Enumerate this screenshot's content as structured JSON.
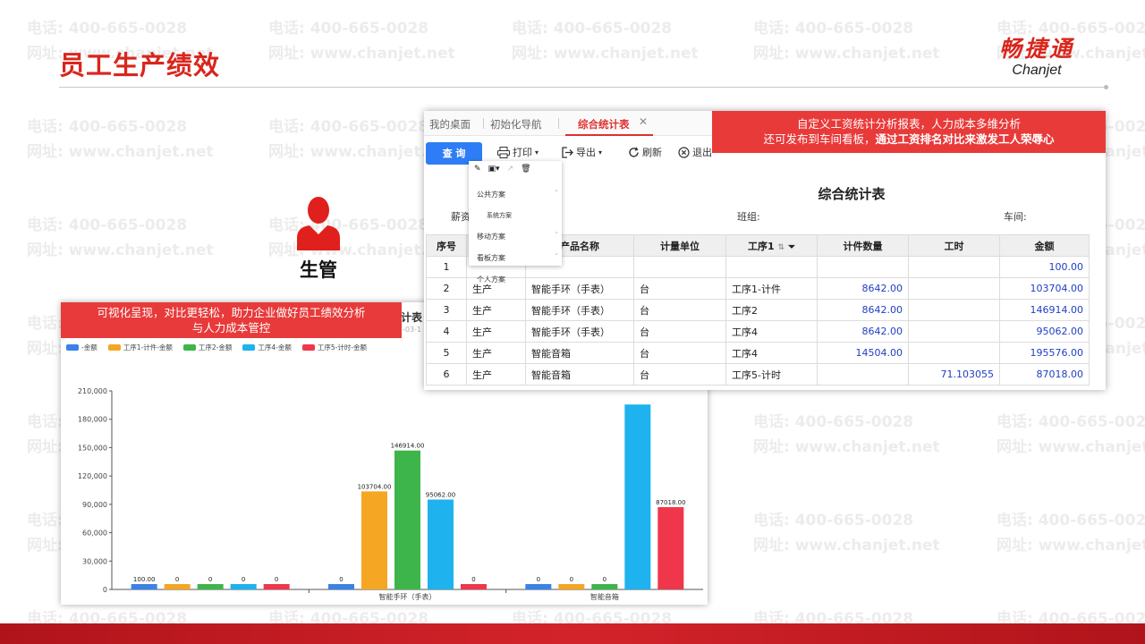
{
  "watermark": {
    "phone": "电话: 400-665-0028",
    "site": "网址: www.chanjet.net"
  },
  "slide": {
    "title": "员工生产绩效"
  },
  "logo": {
    "cn": "畅捷通",
    "en": "Chanjet"
  },
  "role": {
    "label": "生管"
  },
  "colors": {
    "brand_red": "#d9261c",
    "banner_red": "#e83a3a",
    "query_blue": "#2f7df6",
    "number_blue": "#1f3ec4"
  },
  "chart_banner": {
    "line1": "可视化呈现，对比更轻松，助力企业做好员工绩效分析",
    "line2": "与人力成本管控"
  },
  "chart_peek": {
    "title": "计表",
    "date": "-03-1"
  },
  "window": {
    "tabs": [
      {
        "label": "我的桌面"
      },
      {
        "label": "初始化导航"
      },
      {
        "label": "综合统计表"
      }
    ],
    "banner": {
      "line1": "自定义工资统计分析报表，人力成本多维分析",
      "line2_plain": "还可发布到车间看板，",
      "line2_bold": "通过工资排名对比来激发工人荣辱心"
    },
    "toolbar": {
      "query": "查 询",
      "print": "打印",
      "export": "导出",
      "refresh": "刷新",
      "exit": "退出"
    },
    "menu": {
      "public": "公共方案",
      "system": "系统方案",
      "mobile": "移动方案",
      "board": "看板方案",
      "personal": "个人方案"
    },
    "report_title": "综合统计表",
    "filters": {
      "salary": "薪资",
      "team": "班组:",
      "workshop": "车间:"
    },
    "table": {
      "headers": [
        "序号",
        "",
        "产品名称",
        "计量单位",
        "工序1",
        "计件数量",
        "工时",
        "金额"
      ],
      "rows": [
        [
          "1",
          "",
          "",
          "",
          "",
          "",
          "",
          "100.00"
        ],
        [
          "2",
          "生产",
          "智能手环（手表）",
          "台",
          "工序1-计件",
          "8642.00",
          "",
          "103704.00"
        ],
        [
          "3",
          "生产",
          "智能手环（手表）",
          "台",
          "工序2",
          "8642.00",
          "",
          "146914.00"
        ],
        [
          "4",
          "生产",
          "智能手环（手表）",
          "台",
          "工序4",
          "8642.00",
          "",
          "95062.00"
        ],
        [
          "5",
          "生产",
          "智能音箱",
          "台",
          "工序4",
          "14504.00",
          "",
          "195576.00"
        ],
        [
          "6",
          "生产",
          "智能音箱",
          "台",
          "工序5-计时",
          "",
          "71.103055",
          "87018.00"
        ]
      ]
    }
  },
  "chart_data": {
    "type": "bar",
    "categories": [
      "",
      "智能手环（手表）",
      "智能音箱"
    ],
    "ylim": [
      0,
      210000
    ],
    "yticks": [
      0,
      30000,
      60000,
      90000,
      120000,
      150000,
      180000,
      210000
    ],
    "ytick_labels": [
      "0",
      "30,000",
      "60,000",
      "90,000",
      "120,000",
      "150,000",
      "180,000",
      "210,000"
    ],
    "grid": false,
    "legend_position": "top-left",
    "series": [
      {
        "name": "-金额",
        "color": "#3b82e6",
        "values": [
          100,
          0,
          0
        ],
        "labels": [
          "100.00",
          "0",
          "0"
        ]
      },
      {
        "name": "工序1-计件-金额",
        "color": "#f5a623",
        "values": [
          0,
          103704,
          0
        ],
        "labels": [
          "0",
          "103704.00",
          "0"
        ]
      },
      {
        "name": "工序2-金额",
        "color": "#3db54a",
        "values": [
          0,
          146914,
          0
        ],
        "labels": [
          "0",
          "146914.00",
          "0"
        ]
      },
      {
        "name": "工序4-金额",
        "color": "#1eb2ee",
        "values": [
          0,
          95062,
          195576
        ],
        "labels": [
          "0",
          "95062.00",
          ""
        ]
      },
      {
        "name": "工序5-计时-金额",
        "color": "#f0364b",
        "values": [
          0,
          0,
          87018
        ],
        "labels": [
          "0",
          "0",
          "87018.00"
        ]
      }
    ]
  }
}
